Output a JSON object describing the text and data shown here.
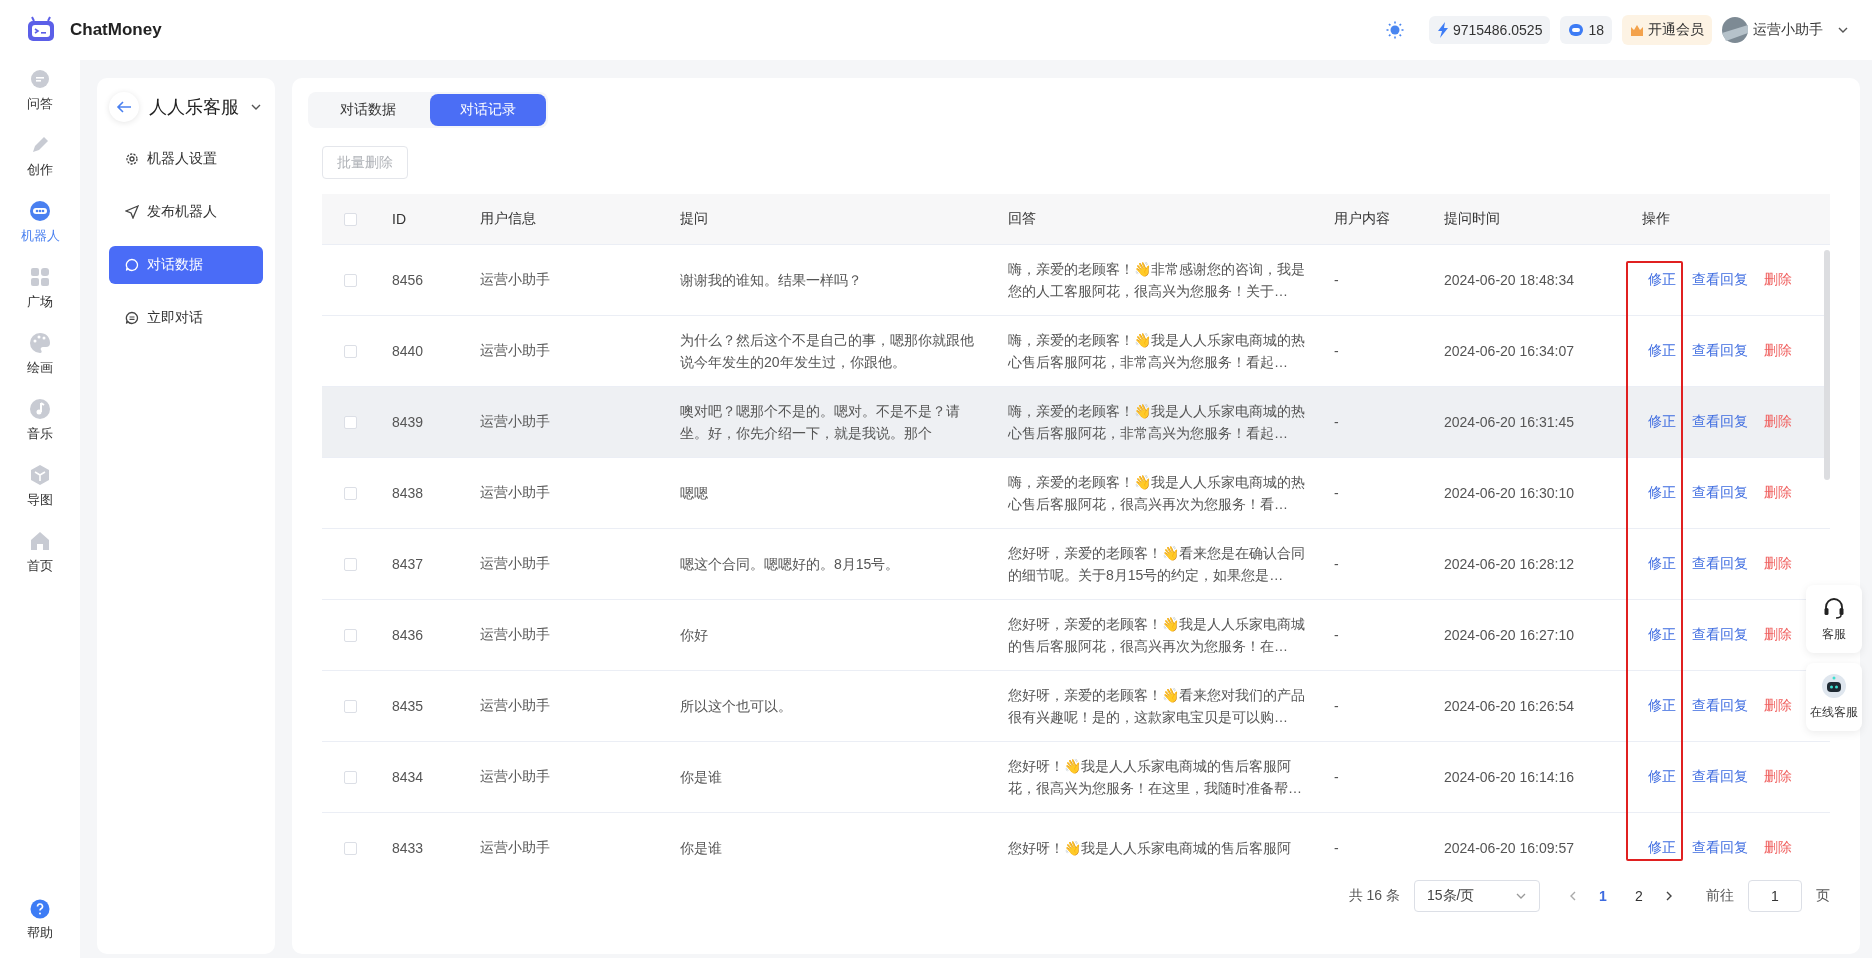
{
  "header": {
    "logo_text": "ChatMoney",
    "balance": "9715486.0525",
    "tokens": "18",
    "vip_label": "开通会员",
    "user_name": "运营小助手"
  },
  "nav": {
    "items": [
      {
        "label": "问答",
        "selected": false
      },
      {
        "label": "创作",
        "selected": false
      },
      {
        "label": "机器人",
        "selected": true
      },
      {
        "label": "广场",
        "selected": false
      },
      {
        "label": "绘画",
        "selected": false
      },
      {
        "label": "音乐",
        "selected": false
      },
      {
        "label": "导图",
        "selected": false
      },
      {
        "label": "首页",
        "selected": false
      }
    ],
    "help": "帮助"
  },
  "sidebar": {
    "title": "人人乐客服",
    "items": [
      {
        "label": "机器人设置",
        "selected": false
      },
      {
        "label": "发布机器人",
        "selected": false
      },
      {
        "label": "对话数据",
        "selected": true
      },
      {
        "label": "立即对话",
        "selected": false
      }
    ]
  },
  "tabs": [
    {
      "label": "对话数据",
      "selected": false
    },
    {
      "label": "对话记录",
      "selected": true
    }
  ],
  "batch_delete": {
    "label": "批量删除",
    "disabled": true
  },
  "table": {
    "all_checked": false,
    "columns": [
      "ID",
      "用户信息",
      "提问",
      "回答",
      "用户内容",
      "提问时间",
      "操作"
    ],
    "rows": [
      {
        "checked": false,
        "highlighted": false,
        "id": "8456",
        "user": "运营小助手",
        "question": "谢谢我的谁知。结果一样吗？",
        "answer": "嗨，亲爱的老顾客！👋非常感谢您的咨询，我是您的人工客服阿花，很高兴为您服务！关于…",
        "user_content": "-",
        "time": "2024-06-20 18:48:34",
        "actions": [
          {
            "label": "修正",
            "kind": "link"
          },
          {
            "label": "查看回复",
            "kind": "link"
          },
          {
            "label": "删除",
            "kind": "danger"
          }
        ]
      },
      {
        "checked": false,
        "highlighted": false,
        "id": "8440",
        "user": "运营小助手",
        "question": "为什么？然后这个不是自己的事，嗯那你就跟他说今年发生的20年发生过，你跟他。",
        "answer": "嗨，亲爱的老顾客！👋我是人人乐家电商城的热心售后客服阿花，非常高兴为您服务！看起…",
        "user_content": "-",
        "time": "2024-06-20 16:34:07",
        "actions": [
          {
            "label": "修正",
            "kind": "link"
          },
          {
            "label": "查看回复",
            "kind": "link"
          },
          {
            "label": "删除",
            "kind": "danger"
          }
        ]
      },
      {
        "checked": false,
        "highlighted": true,
        "id": "8439",
        "user": "运营小助手",
        "question": "噢对吧？嗯那个不是的。嗯对。不是不是？请坐。好，你先介绍一下，就是我说。那个",
        "answer": "嗨，亲爱的老顾客！👋我是人人乐家电商城的热心售后客服阿花，非常高兴为您服务！看起…",
        "user_content": "-",
        "time": "2024-06-20 16:31:45",
        "actions": [
          {
            "label": "修正",
            "kind": "link"
          },
          {
            "label": "查看回复",
            "kind": "link"
          },
          {
            "label": "删除",
            "kind": "danger"
          }
        ]
      },
      {
        "checked": false,
        "highlighted": false,
        "id": "8438",
        "user": "运营小助手",
        "question": "嗯嗯",
        "answer": "嗨，亲爱的老顾客！👋我是人人乐家电商城的热心售后客服阿花，很高兴再次为您服务！看…",
        "user_content": "-",
        "time": "2024-06-20 16:30:10",
        "actions": [
          {
            "label": "修正",
            "kind": "link"
          },
          {
            "label": "查看回复",
            "kind": "link"
          },
          {
            "label": "删除",
            "kind": "danger"
          }
        ]
      },
      {
        "checked": false,
        "highlighted": false,
        "id": "8437",
        "user": "运营小助手",
        "question": "嗯这个合同。嗯嗯好的。8月15号。",
        "answer": "您好呀，亲爱的老顾客！👋看来您是在确认合同的细节呢。关于8月15号的约定，如果您是…",
        "user_content": "-",
        "time": "2024-06-20 16:28:12",
        "actions": [
          {
            "label": "修正",
            "kind": "link"
          },
          {
            "label": "查看回复",
            "kind": "link"
          },
          {
            "label": "删除",
            "kind": "danger"
          }
        ]
      },
      {
        "checked": false,
        "highlighted": false,
        "id": "8436",
        "user": "运营小助手",
        "question": "你好",
        "answer": "您好呀，亲爱的老顾客！👋我是人人乐家电商城的售后客服阿花，很高兴再次为您服务！在…",
        "user_content": "-",
        "time": "2024-06-20 16:27:10",
        "actions": [
          {
            "label": "修正",
            "kind": "link"
          },
          {
            "label": "查看回复",
            "kind": "link"
          },
          {
            "label": "删除",
            "kind": "danger"
          }
        ]
      },
      {
        "checked": false,
        "highlighted": false,
        "id": "8435",
        "user": "运营小助手",
        "question": "所以这个也可以。",
        "answer": "您好呀，亲爱的老顾客！👋看来您对我们的产品很有兴趣呢！是的，这款家电宝贝是可以购…",
        "user_content": "-",
        "time": "2024-06-20 16:26:54",
        "actions": [
          {
            "label": "修正",
            "kind": "link"
          },
          {
            "label": "查看回复",
            "kind": "link"
          },
          {
            "label": "删除",
            "kind": "danger"
          }
        ]
      },
      {
        "checked": false,
        "highlighted": false,
        "id": "8434",
        "user": "运营小助手",
        "question": "你是谁",
        "answer": "您好呀！👋我是人人乐家电商城的售后客服阿花，很高兴为您服务！在这里，我随时准备帮…",
        "user_content": "-",
        "time": "2024-06-20 16:14:16",
        "actions": [
          {
            "label": "修正",
            "kind": "link"
          },
          {
            "label": "查看回复",
            "kind": "link"
          },
          {
            "label": "删除",
            "kind": "danger"
          }
        ]
      },
      {
        "checked": false,
        "highlighted": false,
        "id": "8433",
        "user": "运营小助手",
        "question": "你是谁",
        "answer": "您好呀！👋我是人人乐家电商城的售后客服阿",
        "user_content": "-",
        "time": "2024-06-20 16:09:57",
        "actions": [
          {
            "label": "修正",
            "kind": "link"
          },
          {
            "label": "查看回复",
            "kind": "link"
          },
          {
            "label": "删除",
            "kind": "danger"
          }
        ]
      }
    ]
  },
  "pagination": {
    "total": "共 16 条",
    "page_size": "15条/页",
    "pages": [
      {
        "label": "1",
        "selected": true
      },
      {
        "label": "2",
        "selected": false
      }
    ],
    "goto_label": "前往",
    "goto_value": "1",
    "page_suffix": "页"
  },
  "float_buttons": [
    {
      "label": "客服"
    },
    {
      "label": "在线客服"
    }
  ]
}
